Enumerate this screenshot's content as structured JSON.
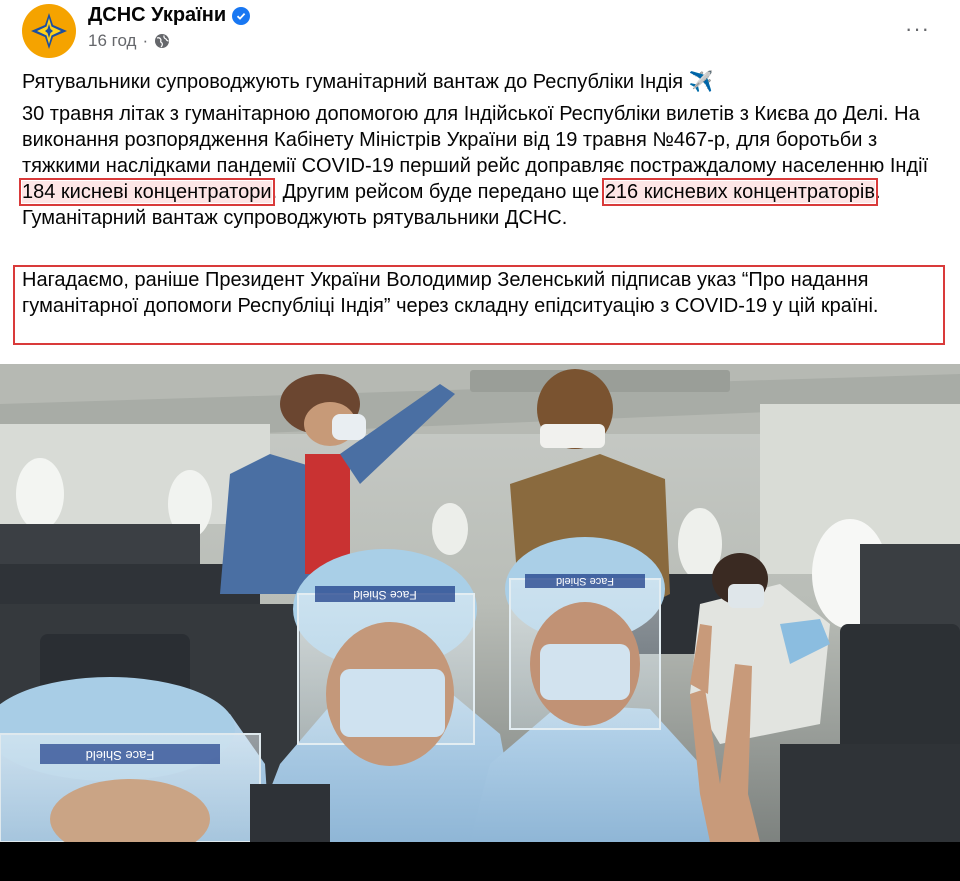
{
  "post": {
    "page_name": "ДСНС України",
    "time": "16 год",
    "separator": "·",
    "more": "···",
    "title": "Рятувальники супроводжують гуманітарний вантаж до Республіки Індія ✈️",
    "body": {
      "p1_part1": "30 травня літак з гуманітарною допомогою для Індійської Республіки вилетів з Києва до Делі. На виконання розпорядження Кабінету Міністрів України від 19 травня №467-р, для боротьби з тяжкими наслідками пандемії COVID-19 перший рейс доправляє постраждалому населенню Індії ",
      "highlight1": "184 кисневі концентратори",
      "p1_part2": ". Другим рейсом буде передано ще ",
      "highlight2": "216 кисневих концентраторів",
      "p1_part3": ". Гуманітарний вантаж супроводжують рятувальники ДСНС.",
      "p2": "Нагадаємо, раніше Президент України Володимир Зеленський підписав указ “Про надання гуманітарної допомоги Республіці Індія” через складну епідситуацію з COVID-19 у цій країні."
    }
  },
  "photo": {
    "shield_text_1": "Face Shield",
    "shield_text_2": "Face Shield",
    "shield_text_3": "Face Shield"
  },
  "colors": {
    "highlight_border": "#d93a3a",
    "verified": "#1877f2",
    "avatar": "#f5a300",
    "meta_text": "#65676b"
  }
}
